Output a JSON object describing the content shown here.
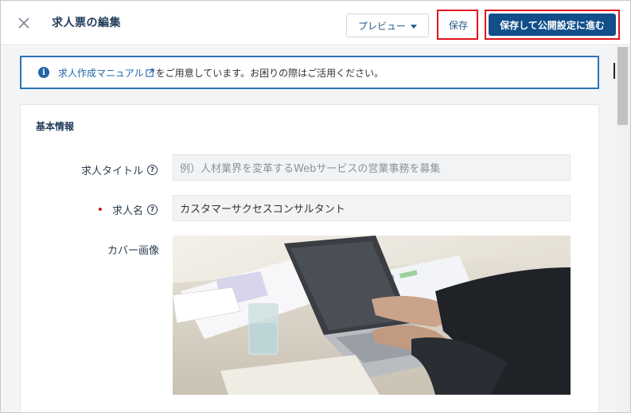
{
  "header": {
    "title": "求人票の編集",
    "preview_label": "プレビュー",
    "save_label": "保存",
    "publish_label": "保存して公開設定に進む"
  },
  "notice": {
    "link_text": "求人作成マニュアル",
    "text": "をご用意しています。お困りの際はご活用ください。"
  },
  "form": {
    "section_title": "基本情報",
    "job_title_label": "求人タイトル",
    "job_title_placeholder": "例）人材業界を変革するWebサービスの営業事務を募集",
    "job_name_label": "求人名",
    "job_name_value": "カスタマーサクセスコンサルタント",
    "cover_label": "カバー画像"
  },
  "colors": {
    "primary": "#114e8a",
    "link": "#2463a8",
    "highlight": "#e0141e",
    "required": "#d0131a"
  },
  "icons": [
    "close-icon",
    "chevron-down-icon",
    "info-icon",
    "external-link-icon",
    "help-icon"
  ]
}
